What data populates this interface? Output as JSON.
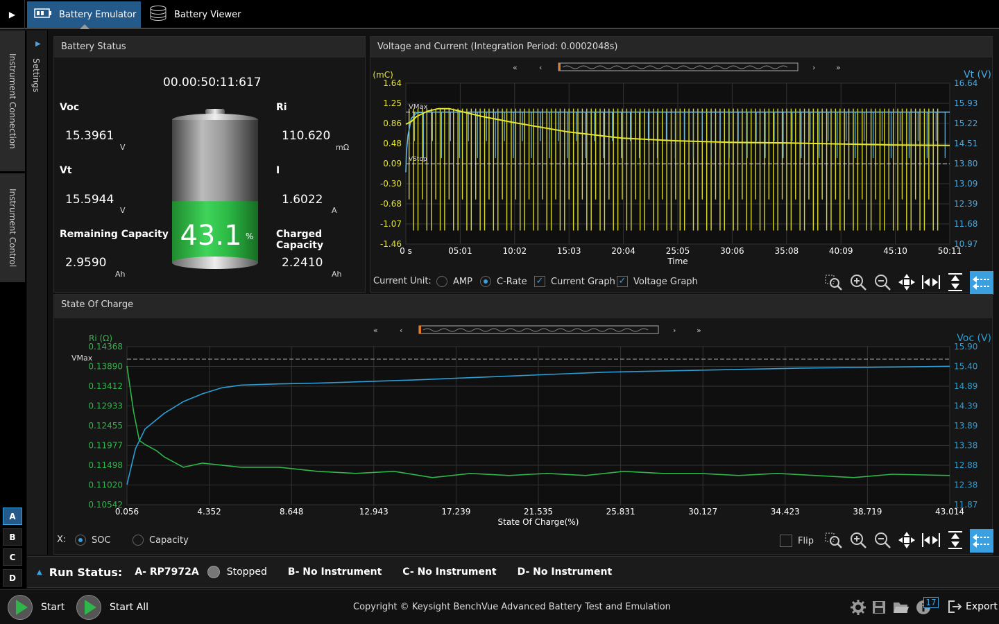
{
  "tabs": [
    {
      "label": "Battery Emulator"
    },
    {
      "label": "Battery Viewer"
    }
  ],
  "sidebar": {
    "connection_label": "Instrument Connection",
    "control_label": "Instrument Control",
    "settings_label": "Settings",
    "channels": [
      "A",
      "B",
      "C",
      "D"
    ]
  },
  "status": {
    "title": "Battery Status",
    "timer": "00.00:50:11:617",
    "voc": {
      "label": "Voc",
      "value": "15.3961",
      "unit": "V"
    },
    "vt": {
      "label": "Vt",
      "value": "15.5944",
      "unit": "V"
    },
    "remaining": {
      "label": "Remaining Capacity",
      "value": "2.9590",
      "unit": "Ah"
    },
    "ri": {
      "label": "Ri",
      "value": "110.620",
      "unit": "mΩ"
    },
    "i": {
      "label": "I",
      "value": "1.6022",
      "unit": "A"
    },
    "charged": {
      "label": "Charged Capacity",
      "value": "2.2410",
      "unit": "Ah"
    },
    "soc_percent": 43.1,
    "soc_text": "43.1",
    "soc_unit": "%"
  },
  "vc_panel": {
    "title": "Voltage and Current (Integration Period: 0.0002048s)",
    "current_unit_label": "Current Unit:",
    "options": {
      "amp": "AMP",
      "crate": "C-Rate",
      "current_graph": "Current Graph",
      "voltage_graph": "Voltage Graph"
    }
  },
  "soc_panel": {
    "title": "State Of Charge",
    "x_label": "X:",
    "options": {
      "soc": "SOC",
      "capacity": "Capacity",
      "flip": "Flip"
    }
  },
  "chart_data": [
    {
      "type": "line",
      "xlabel": "Time",
      "ylabel_left": "I (mC)",
      "ylabel_right": "Vt (V)",
      "x_ticks": [
        "0 s",
        "05:01",
        "10:02",
        "15:03",
        "20:04",
        "25:05",
        "30:06",
        "35:08",
        "40:09",
        "45:10",
        "50:11"
      ],
      "y_left_ticks": [
        "1.64",
        "1.25",
        "0.86",
        "0.48",
        "0.09",
        "-0.30",
        "-0.68",
        "-1.07",
        "-1.46"
      ],
      "y_right_ticks": [
        "16.64",
        "15.93",
        "15.22",
        "14.51",
        "13.80",
        "13.09",
        "12.39",
        "11.68",
        "10.97"
      ],
      "annotations": [
        "VMax",
        "VStop"
      ],
      "series": [
        {
          "name": "Vt",
          "color": "#5fb8e6",
          "x": [
            0,
            0.05,
            0.2,
            0.5,
            1,
            2,
            3,
            5,
            10,
            15,
            20,
            25,
            30,
            35,
            40,
            45,
            50.2
          ],
          "y": [
            13.5,
            14.2,
            14.8,
            15.4,
            15.6,
            15.62,
            15.62,
            15.62,
            15.62,
            15.62,
            15.62,
            15.62,
            15.62,
            15.62,
            15.62,
            15.62,
            15.62
          ]
        },
        {
          "name": "I",
          "color": "#e6e62e",
          "x": [
            0,
            0.5,
            1,
            2,
            3,
            4,
            5,
            7,
            10,
            15,
            20,
            25,
            30,
            35,
            40,
            45,
            50.2
          ],
          "y": [
            0.85,
            0.9,
            1.0,
            1.1,
            1.15,
            1.15,
            1.1,
            1.0,
            0.88,
            0.7,
            0.58,
            0.53,
            0.5,
            0.49,
            0.47,
            0.45,
            0.44
          ]
        }
      ]
    },
    {
      "type": "line",
      "xlabel": "State Of Charge(%)",
      "ylabel_left": "Ri (Ω)",
      "ylabel_right": "Voc (V)",
      "x_ticks": [
        "0.056",
        "4.352",
        "8.648",
        "12.943",
        "17.239",
        "21.535",
        "25.831",
        "30.127",
        "34.423",
        "38.719",
        "43.014"
      ],
      "y_left_ticks": [
        "0.14368",
        "0.13890",
        "0.13412",
        "0.12933",
        "0.12455",
        "0.11977",
        "0.11498",
        "0.11020",
        "0.10542"
      ],
      "y_right_ticks": [
        "15.90",
        "15.40",
        "14.89",
        "14.39",
        "13.89",
        "13.38",
        "12.88",
        "12.38",
        "11.87"
      ],
      "annotations": [
        "VMax"
      ],
      "series": [
        {
          "name": "Voc",
          "color": "#2a9fd6",
          "x": [
            0.056,
            0.5,
            1,
            2,
            3,
            4,
            5,
            6,
            8,
            10,
            15,
            20,
            25,
            30,
            35,
            40,
            43.014
          ],
          "y": [
            12.38,
            13.3,
            13.8,
            14.2,
            14.5,
            14.7,
            14.85,
            14.92,
            14.95,
            14.97,
            15.05,
            15.15,
            15.25,
            15.3,
            15.35,
            15.38,
            15.4
          ]
        },
        {
          "name": "Ri",
          "color": "#2fb64a",
          "x": [
            0.056,
            0.4,
            0.7,
            1,
            1.6,
            2,
            3,
            4,
            5,
            6,
            8,
            10,
            12,
            14,
            16,
            18,
            20,
            22,
            24,
            26,
            28,
            30,
            32,
            34,
            36,
            38,
            40,
            43.014
          ],
          "y": [
            0.139,
            0.128,
            0.121,
            0.12,
            0.1185,
            0.117,
            0.1145,
            0.1155,
            0.115,
            0.1145,
            0.1145,
            0.1135,
            0.113,
            0.1135,
            0.112,
            0.113,
            0.1125,
            0.113,
            0.1125,
            0.1135,
            0.113,
            0.113,
            0.1125,
            0.113,
            0.1125,
            0.112,
            0.1128,
            0.1125
          ]
        }
      ]
    }
  ],
  "run_status": {
    "label": "Run Status:",
    "a": "A- RP7972A",
    "a_state": "Stopped",
    "b": "B- No Instrument",
    "c": "C- No Instrument",
    "d": "D- No Instrument"
  },
  "footer": {
    "start": "Start",
    "start_all": "Start All",
    "copyright": "Copyright © Keysight BenchVue Advanced Battery Test and Emulation",
    "badge": "17",
    "export": "Export"
  },
  "colors": {
    "accent": "#235a8a",
    "green": "#2fb64a",
    "yellow": "#e6e62e",
    "blue": "#2a9fd6"
  }
}
